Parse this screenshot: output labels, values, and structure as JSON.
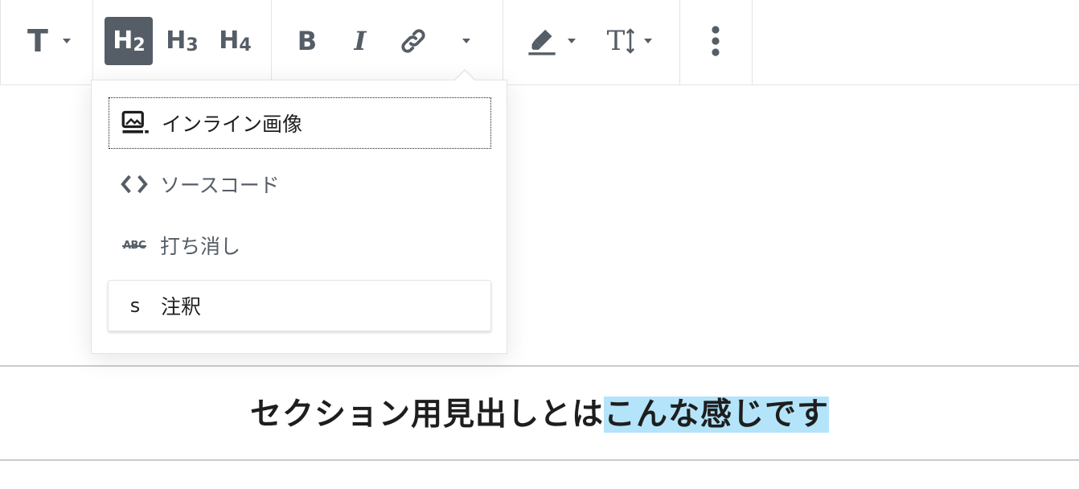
{
  "toolbar": {
    "block_type_icon": "T",
    "headings": [
      {
        "prefix": "H",
        "level": "2",
        "active": true
      },
      {
        "prefix": "H",
        "level": "3",
        "active": false
      },
      {
        "prefix": "H",
        "level": "4",
        "active": false
      }
    ],
    "format_icons": [
      "bold-icon",
      "italic-icon",
      "link-icon",
      "more-formats-caret-icon"
    ],
    "bold_label": "B",
    "italic_label": "I",
    "text_size_label": "T",
    "icons": {
      "highlight": "highlighter-icon",
      "text_size": "text-size-icon",
      "more": "more-vertical-icon"
    }
  },
  "dropdown": {
    "items": [
      {
        "icon": "inline-image-icon",
        "label": "インライン画像"
      },
      {
        "icon": "code-brackets-icon",
        "label": "ソースコード"
      },
      {
        "icon": "strikethrough-icon",
        "icon_text": "ABC",
        "label": "打ち消し"
      },
      {
        "icon": "annotation-s-icon",
        "icon_text": "s",
        "label": "注釈"
      }
    ]
  },
  "content": {
    "heading_plain": "セクション用見出しとは",
    "heading_selected": "こんな感じです"
  }
}
